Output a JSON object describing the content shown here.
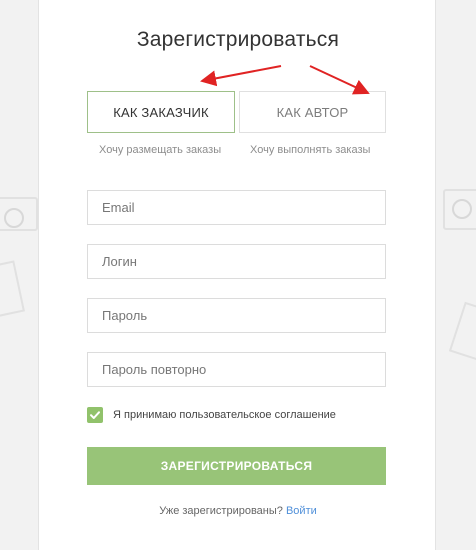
{
  "page": {
    "title": "Зарегистрироваться"
  },
  "tabs": [
    {
      "label": "КАК ЗАКАЗЧИК",
      "note": "Хочу размещать заказы",
      "active": true
    },
    {
      "label": "КАК АВТОР",
      "note": "Хочу выполнять заказы",
      "active": false
    }
  ],
  "form": {
    "email_placeholder": "Email",
    "login_placeholder": "Логин",
    "password_placeholder": "Пароль",
    "repeat_password_placeholder": "Пароль повторно",
    "agreement_label": "Я принимаю пользовательское соглашение",
    "agreement_checked": true,
    "submit_label": "ЗАРЕГИСТРИРОВАТЬСЯ"
  },
  "footer": {
    "question": "Уже зарегистрированы?",
    "login_link": "Войти"
  },
  "colors": {
    "accent_green": "#98c478",
    "active_tab_border": "#9ec089",
    "link_blue": "#4f8fd9",
    "arrow_red": "#e02323"
  },
  "icons": {
    "checkbox": "check-icon",
    "annotations": "red-arrow-icon"
  }
}
